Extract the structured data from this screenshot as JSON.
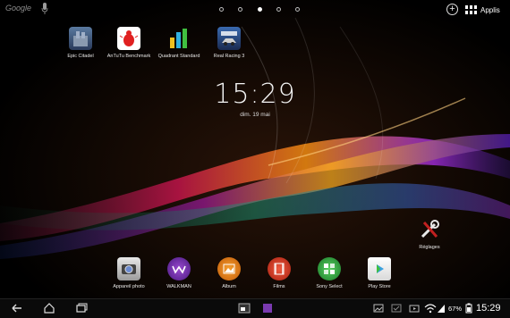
{
  "search": {
    "label": "Google"
  },
  "pages": {
    "count": 5,
    "active": 2
  },
  "top_right": {
    "add_label": "+",
    "apps_label": "Applis"
  },
  "home_apps": [
    {
      "label": "Epic Citadel",
      "icon": "epic-citadel-icon",
      "color": "#4a6a8c"
    },
    {
      "label": "AnTuTu Benchmark",
      "icon": "antutu-icon",
      "color": "#e02020"
    },
    {
      "label": "Quadrant Standard",
      "icon": "quadrant-icon",
      "color": "#1aa0d8"
    },
    {
      "label": "Real Racing 3",
      "icon": "real-racing-icon",
      "color": "#2a5aa0"
    }
  ],
  "clock": {
    "time": "15:29",
    "date": "dim. 19 mai"
  },
  "settings_shortcut": {
    "label": "Réglages",
    "icon": "wrench-screwdriver-icon"
  },
  "dock": [
    {
      "label": "Appareil photo",
      "icon": "camera-icon",
      "color": "#d0d0d0"
    },
    {
      "label": "WALKMAN",
      "icon": "walkman-icon",
      "color": "#6a2aa0"
    },
    {
      "label": "Album",
      "icon": "album-icon",
      "color": "#e07a10"
    },
    {
      "label": "Films",
      "icon": "films-icon",
      "color": "#d83a20"
    },
    {
      "label": "Sony Select",
      "icon": "sony-select-icon",
      "color": "#2aa040"
    },
    {
      "label": "Play Store",
      "icon": "play-store-icon",
      "color": "#f0f0f0"
    }
  ],
  "status": {
    "battery": "67%",
    "time": "15:29"
  }
}
